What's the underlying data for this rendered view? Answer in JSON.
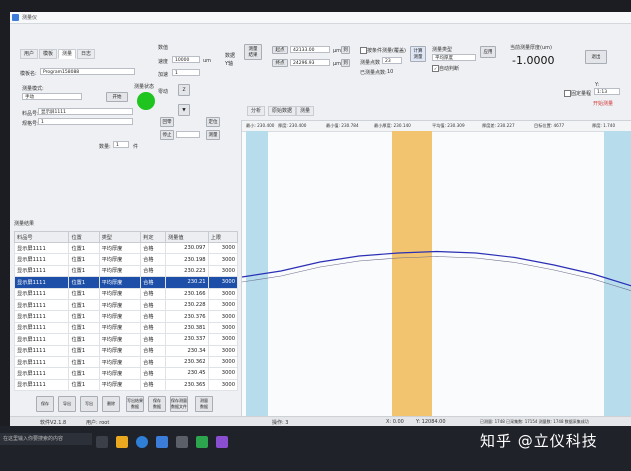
{
  "window": {
    "title": "测量仪"
  },
  "tabs": [
    {
      "label": "用户"
    },
    {
      "label": "模板"
    },
    {
      "label": "测量"
    },
    {
      "label": "日志"
    }
  ],
  "left_panel": {
    "template_label": "模板名:",
    "template_value": "Program158088",
    "mode_label": "测量模式:",
    "mode_value": "手动",
    "start_button": "开始",
    "status_label": "测量状态",
    "part_name_label": "料品号:",
    "part_name_value": "显示屏1111",
    "spec_label": "规格号:",
    "spec_value": "1",
    "count_label": "数量:",
    "count_value": "1",
    "count_unit": "件"
  },
  "mid_panel": {
    "title": "数值",
    "speed_label": "速度",
    "speed_value": "10000",
    "speed_unit": "um",
    "accel_label": "加速",
    "accel_value": "1",
    "move_label": "零动",
    "z_label": "Z",
    "home_button": "回零",
    "set_button": "定位",
    "stop_button": "停止",
    "measure_button": "测量",
    "side_labels": [
      "数据",
      "Y轴"
    ]
  },
  "top_controls": {
    "save_button": "测量\n结果",
    "start_label": "起点",
    "start_value": "42133.00",
    "start_unit": "μm",
    "end_label": "终点",
    "end_value": "24296.93",
    "end_unit": "μm",
    "go_label": "到",
    "auto_check": "按条件测量(覆盖)",
    "points_label": "测量点数",
    "points_value": "23",
    "measured_points_label": "已测量点数:",
    "measured_points_value": "10",
    "calc_button": "计算\n测量",
    "type_label": "测量类型",
    "type_value": "平均厚度",
    "auto_judge": "自动判断",
    "apply_button": "应用",
    "thickness_label": "当前测量厚度(um)",
    "thickness_value": "-1.0000",
    "exit_button": "退出"
  },
  "chart_toolbar": {
    "tabs": [
      "分析",
      "原始数据",
      "测量"
    ],
    "range_label": "1:13",
    "fixed_label": "固定量程",
    "status_text": "开始测量",
    "y_label": "Y:"
  },
  "readout": [
    "最小: 230.400",
    "厚度: 230.400",
    "最小值: 230.784",
    "最小厚度: 230.140",
    "平均值: 230.309",
    "厚度差: 230.227",
    "目标位置: 4677",
    "厚度: 1.740"
  ],
  "table": {
    "title": "测量结果",
    "columns": [
      "料品号",
      "位置",
      "类型",
      "判定",
      "测量值",
      "上限"
    ],
    "rows": [
      [
        "显示屏1111",
        "位置1",
        "平均厚度",
        "合格",
        "230.097",
        "3000"
      ],
      [
        "显示屏1111",
        "位置1",
        "平均厚度",
        "合格",
        "230.198",
        "3000"
      ],
      [
        "显示屏1111",
        "位置1",
        "平均厚度",
        "合格",
        "230.223",
        "3000"
      ],
      [
        "显示屏1111",
        "位置1",
        "平均厚度",
        "合格",
        "230.21",
        "3000"
      ],
      [
        "显示屏1111",
        "位置1",
        "平均厚度",
        "合格",
        "230.166",
        "3000"
      ],
      [
        "显示屏1111",
        "位置1",
        "平均厚度",
        "合格",
        "230.228",
        "3000"
      ],
      [
        "显示屏1111",
        "位置1",
        "平均厚度",
        "合格",
        "230.376",
        "3000"
      ],
      [
        "显示屏1111",
        "位置1",
        "平均厚度",
        "合格",
        "230.381",
        "3000"
      ],
      [
        "显示屏1111",
        "位置1",
        "平均厚度",
        "合格",
        "230.337",
        "3000"
      ],
      [
        "显示屏1111",
        "位置1",
        "平均厚度",
        "合格",
        "230.34",
        "3000"
      ],
      [
        "显示屏1111",
        "位置1",
        "平均厚度",
        "合格",
        "230.362",
        "3000"
      ],
      [
        "显示屏1111",
        "位置1",
        "平均厚度",
        "合格",
        "230.45",
        "3000"
      ],
      [
        "显示屏1111",
        "位置1",
        "平均厚度",
        "合格",
        "230.365",
        "3000"
      ]
    ],
    "selected_row": 3
  },
  "bottom_buttons": [
    "保存",
    "导出",
    "写出",
    "删除",
    "写出结果\n数据",
    "保存\n数据",
    "保存测量\n数据文件",
    "测量\n数据"
  ],
  "status_bar": {
    "version": "软件V2.1.8",
    "user": "用户: root",
    "operator": "操作: 3",
    "x": "X: 0.00",
    "y": "Y: 12084.00",
    "count": "已测量: 1748 已采集数: 17154 测量数: 1748 数据采集成功"
  },
  "taskbar": {
    "search_placeholder": "在这里输入你要搜索的内容"
  },
  "watermark": "知乎 @立仪科技",
  "colors": {
    "accent": "#1d4fa8",
    "status_green": "#1fc41f",
    "band_orange": "#f2c470",
    "band_blue": "#b7dcec",
    "curve": "#2a2fb5"
  },
  "chart_data": {
    "type": "line",
    "title": "",
    "xlabel": "",
    "ylabel": "",
    "series": [
      {
        "values": [
          0.52,
          0.5,
          0.47,
          0.45,
          0.44,
          0.435,
          0.44,
          0.455,
          0.48,
          0.51,
          0.55
        ]
      }
    ],
    "note_units": "relative"
  }
}
